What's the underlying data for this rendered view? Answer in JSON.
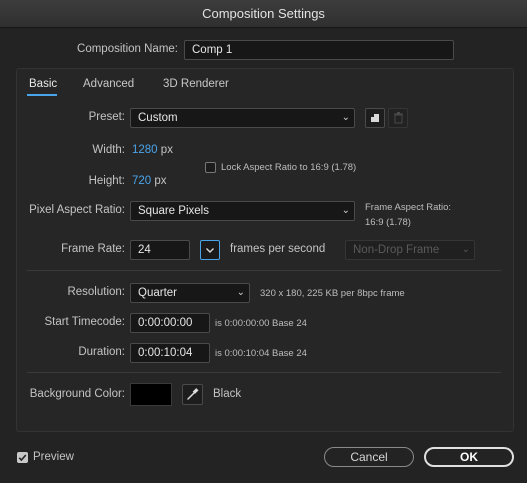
{
  "window": {
    "title": "Composition Settings"
  },
  "comp_name": {
    "label": "Composition Name:",
    "value": "Comp 1"
  },
  "tabs": [
    {
      "label": "Basic",
      "active": true
    },
    {
      "label": "Advanced",
      "active": false
    },
    {
      "label": "3D Renderer",
      "active": false
    }
  ],
  "preset": {
    "label": "Preset:",
    "value": "Custom"
  },
  "width": {
    "label": "Width:",
    "value": "1280",
    "unit": "px"
  },
  "height": {
    "label": "Height:",
    "value": "720",
    "unit": "px"
  },
  "lock_aspect": {
    "label": "Lock Aspect Ratio to 16:9 (1.78)",
    "checked": false
  },
  "pixel_aspect": {
    "label": "Pixel Aspect Ratio:",
    "value": "Square Pixels"
  },
  "frame_aspect": {
    "label": "Frame Aspect Ratio:",
    "value": "16:9 (1.78)"
  },
  "frame_rate": {
    "label": "Frame Rate:",
    "value": "24",
    "unit": "frames per second",
    "drop_frame": "Non-Drop Frame"
  },
  "resolution": {
    "label": "Resolution:",
    "value": "Quarter",
    "info": "320 x 180, 225 KB per 8bpc frame"
  },
  "start_timecode": {
    "label": "Start Timecode:",
    "value": "0:00:00:00",
    "info": "is 0:00:00:00  Base 24"
  },
  "duration": {
    "label": "Duration:",
    "value": "0:00:10:04",
    "info": "is 0:00:10:04  Base 24"
  },
  "background": {
    "label": "Background Color:",
    "color": "#000000",
    "name": "Black"
  },
  "footer": {
    "preview_label": "Preview",
    "preview_checked": true,
    "cancel_label": "Cancel",
    "ok_label": "OK"
  },
  "colors": {
    "accent": "#4aa4ea",
    "background": "#232323"
  },
  "icons": [
    "new-preset-icon",
    "delete-preset-icon",
    "eyedropper-icon",
    "chevron-down-icon",
    "checkmark-icon"
  ]
}
